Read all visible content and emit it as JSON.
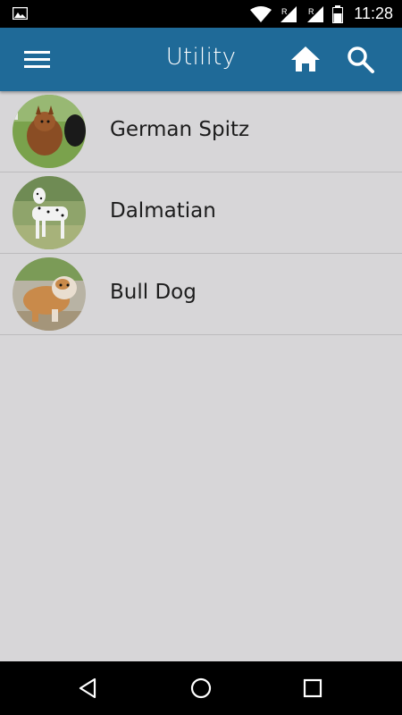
{
  "status_bar": {
    "time": "11:28",
    "icons": [
      "gallery-icon",
      "wifi-icon",
      "signal-icon",
      "signal-icon",
      "battery-icon"
    ]
  },
  "app_bar": {
    "title": "Utility",
    "menu_icon": "menu-icon",
    "home_icon": "home-icon",
    "search_icon": "search-icon",
    "color": "#1f6a98"
  },
  "list": {
    "items": [
      {
        "label": "German Spitz",
        "image": "german-spitz-photo"
      },
      {
        "label": "Dalmatian",
        "image": "dalmatian-photo"
      },
      {
        "label": "Bull Dog",
        "image": "bulldog-photo"
      }
    ]
  },
  "nav_bar": {
    "icons": [
      "back-icon",
      "home-circle-icon",
      "recents-icon"
    ]
  }
}
